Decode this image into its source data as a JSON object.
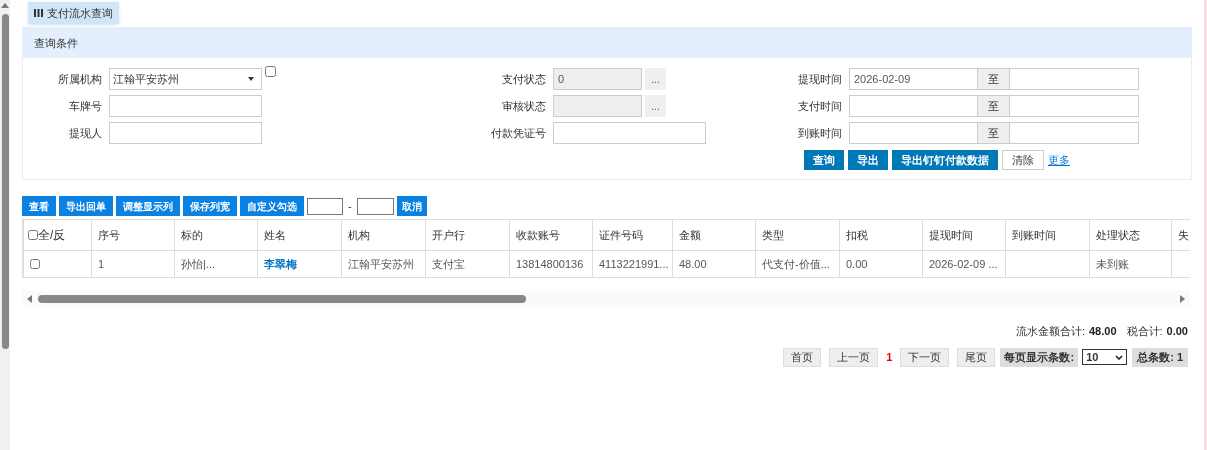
{
  "tab": {
    "label": "支付流水查询"
  },
  "query_panel": {
    "title": "查询条件",
    "rows": [
      [
        {
          "kind": "select",
          "label": "所属机构",
          "value": "江翰平安苏州",
          "checkbox_checked": false
        },
        {
          "kind": "picker",
          "label": "支付状态",
          "value": "0",
          "button": "..."
        },
        {
          "kind": "range",
          "label": "提现时间",
          "from": "2026-02-09",
          "separator": "至"
        }
      ],
      [
        {
          "kind": "text",
          "label": "车牌号"
        },
        {
          "kind": "picker",
          "label": "审核状态",
          "button": "..."
        },
        {
          "kind": "range",
          "label": "支付时间",
          "separator": "至"
        }
      ],
      [
        {
          "kind": "text",
          "label": "提现人"
        },
        {
          "kind": "text",
          "label": "付款凭证号"
        },
        {
          "kind": "range",
          "label": "到账时间",
          "separator": "至"
        }
      ]
    ],
    "actions": [
      {
        "kind": "primary",
        "label": "查询"
      },
      {
        "kind": "primary",
        "label": "导出"
      },
      {
        "kind": "primary",
        "label": "导出钉钉付款数据"
      },
      {
        "kind": "plain",
        "label": "清除"
      },
      {
        "kind": "link",
        "label": "更多"
      }
    ]
  },
  "toolbar": {
    "buttons": [
      "查看",
      "导出回单",
      "调整显示列",
      "保存列宽",
      "自定义勾选"
    ],
    "range_separator": "-",
    "cancel": "取消"
  },
  "table": {
    "select_all": {
      "label": "全/反",
      "checked": false
    },
    "columns": [
      "序号",
      "标的",
      "姓名",
      "机构",
      "开户行",
      "收款账号",
      "证件号码",
      "金额",
      "类型",
      "扣税",
      "提现时间",
      "到账时间",
      "处理状态",
      "失"
    ],
    "rows": [
      {
        "checked": false,
        "cells": [
          {
            "text": "1"
          },
          {
            "text": "孙怡|..."
          },
          {
            "text": "李翠梅",
            "kind": "link"
          },
          {
            "text": "江翰平安苏州"
          },
          {
            "text": "支付宝"
          },
          {
            "text": "13814800136"
          },
          {
            "text": "4113221991..."
          },
          {
            "text": "48.00"
          },
          {
            "text": "代支付-价值..."
          },
          {
            "text": "0.00"
          },
          {
            "text": "2026-02-09 ..."
          },
          {
            "text": ""
          },
          {
            "text": "未到账"
          },
          {
            "text": ""
          }
        ]
      }
    ]
  },
  "summary": {
    "amount_label": "流水金额合计:",
    "amount": "48.00",
    "tax_label": "税合计:",
    "tax": "0.00"
  },
  "pagination": {
    "first": "首页",
    "prev": "上一页",
    "current": "1",
    "next": "下一页",
    "last": "尾页",
    "page_size_label": "每页显示条数:",
    "page_size": "10",
    "total": "总条数: 1"
  }
}
